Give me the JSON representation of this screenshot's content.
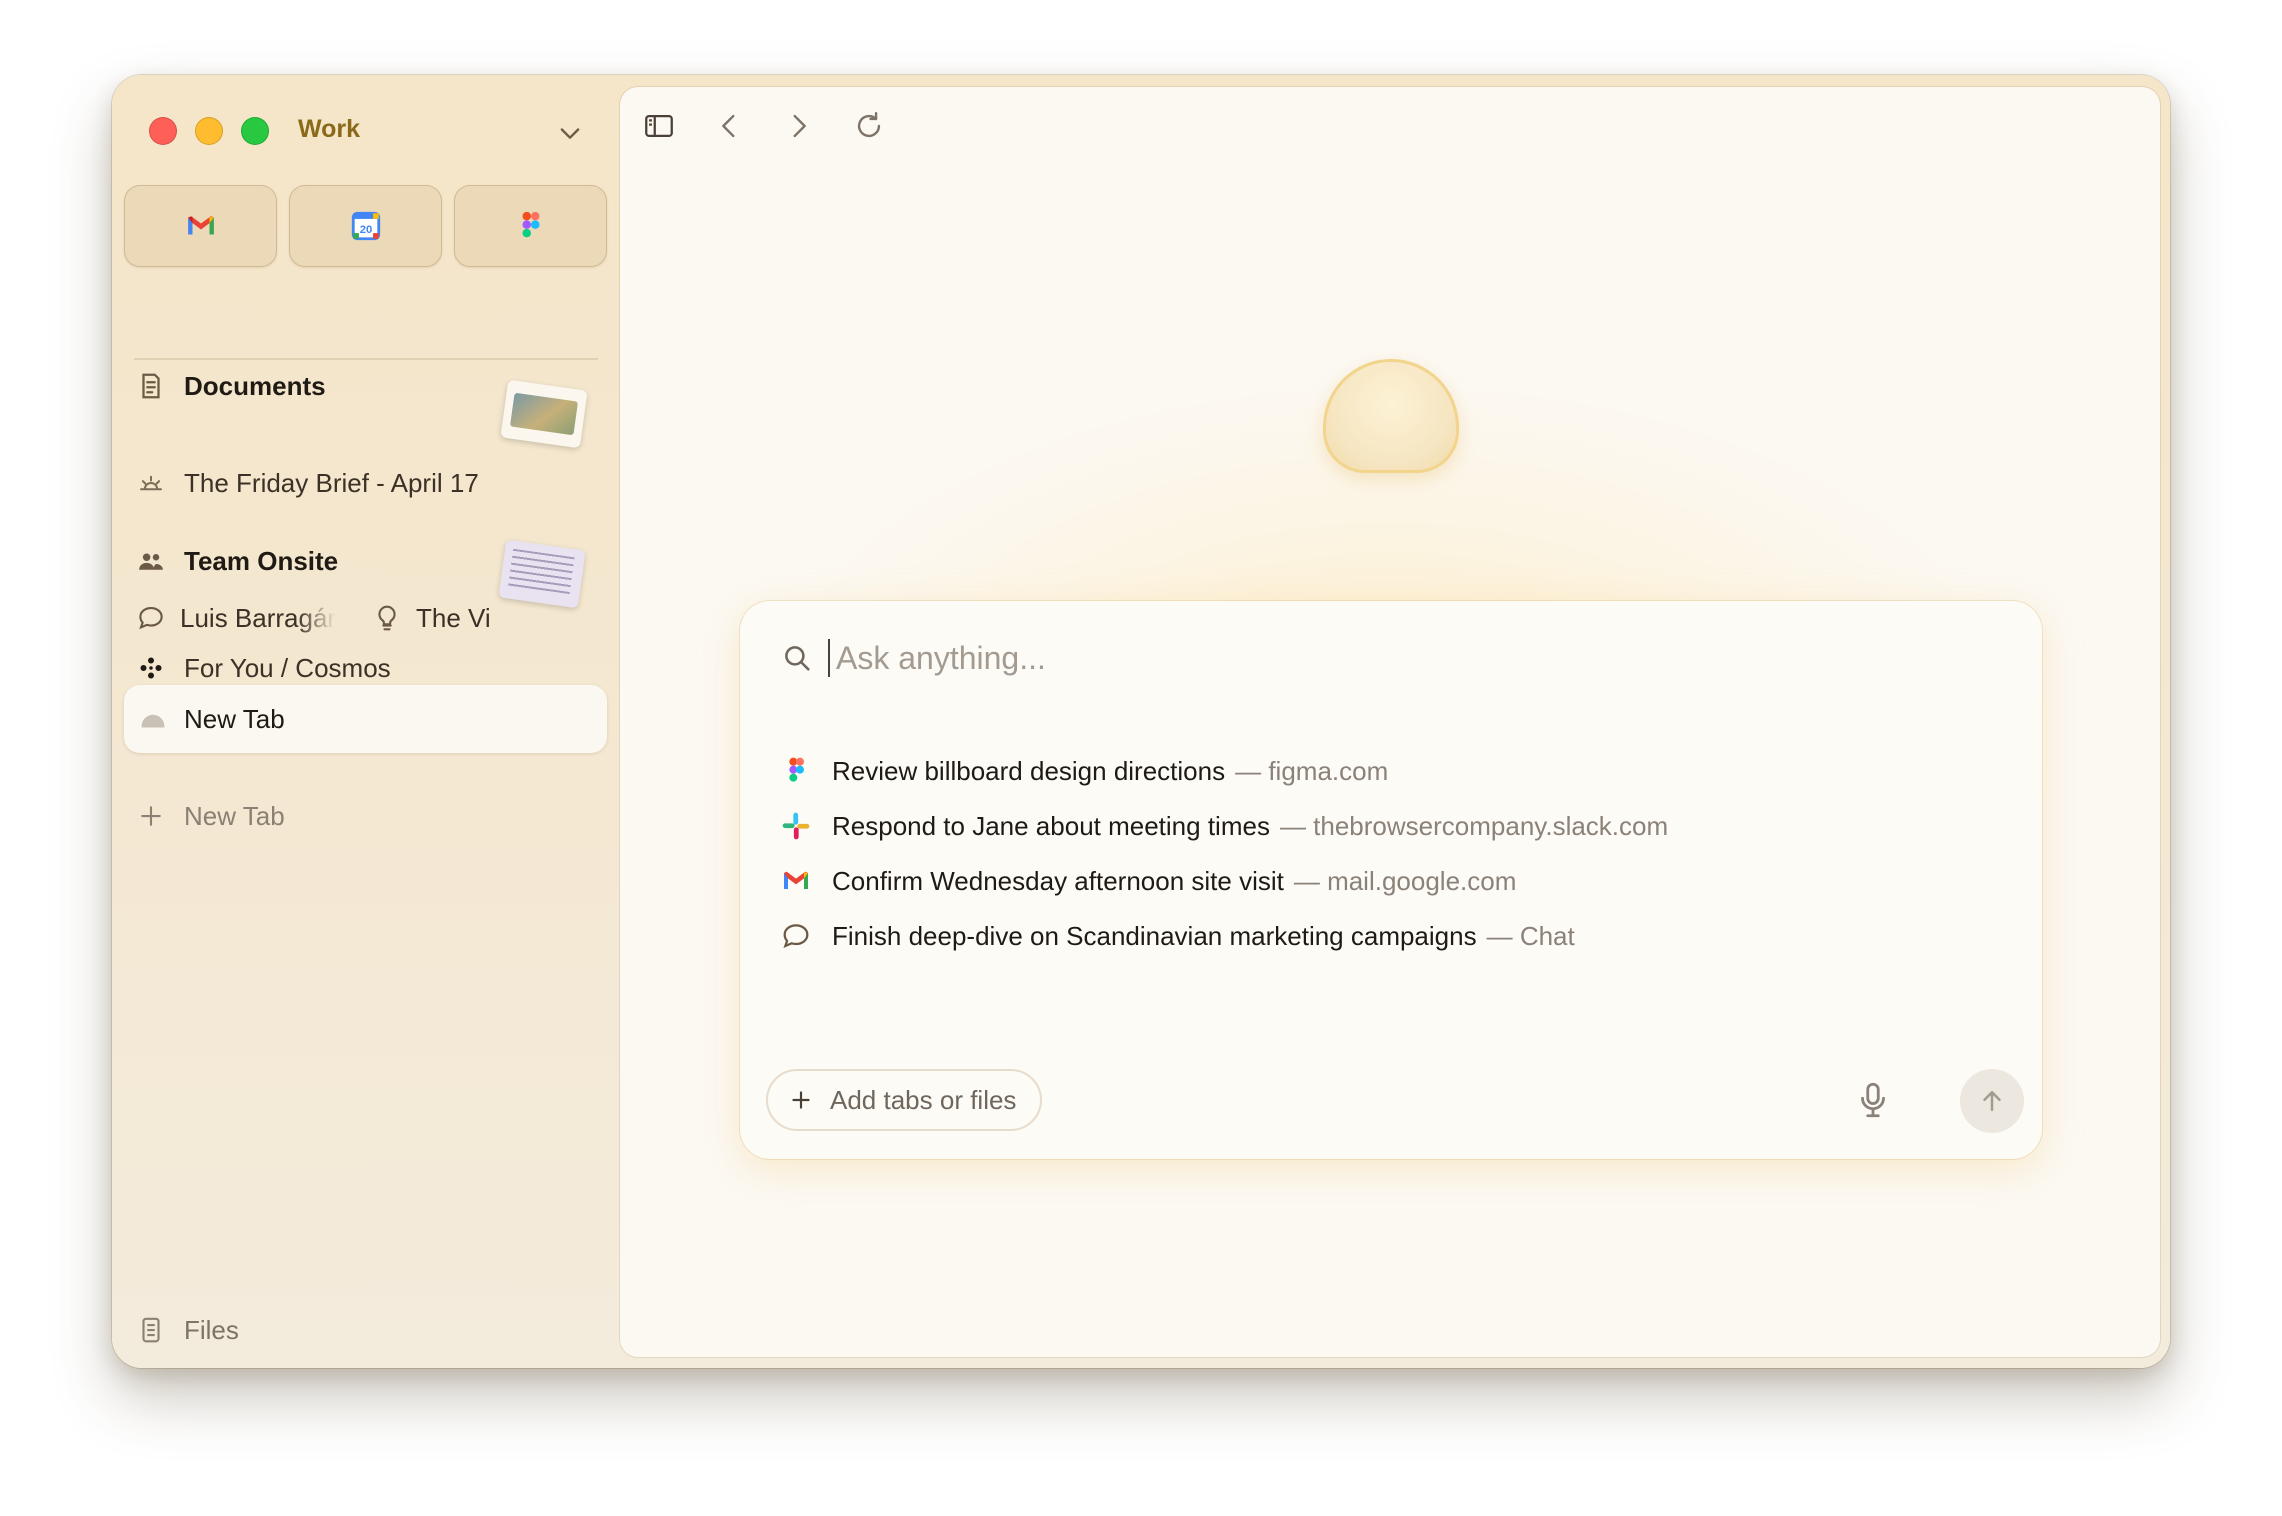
{
  "window": {
    "space_name": "Work",
    "pinned": [
      {
        "icon": "gmail-icon"
      },
      {
        "icon": "google-calendar-icon",
        "badge": "20"
      },
      {
        "icon": "figma-icon"
      }
    ],
    "sidebar": {
      "documents_label": "Documents",
      "items": [
        {
          "label": "The Friday Brief - April 17",
          "icon": "sunrise-icon"
        },
        {
          "label": "Team Onsite",
          "icon": "people-icon"
        },
        {
          "label": "Luis Barragán",
          "icon": "chat-bubble-icon"
        },
        {
          "label": "The Vi",
          "icon": "lightbulb-icon"
        },
        {
          "label": "For You / Cosmos",
          "icon": "cosmos-icon"
        }
      ],
      "active_tab": "New Tab",
      "new_tab_label": "New Tab",
      "files_label": "Files"
    }
  },
  "main": {
    "search_placeholder": "Ask anything...",
    "suggestions": [
      {
        "text": "Review billboard design directions",
        "source": "— figma.com",
        "icon": "figma-icon"
      },
      {
        "text": "Respond to Jane about meeting times",
        "source": "— thebrowsercompany.slack.com",
        "icon": "slack-icon"
      },
      {
        "text": "Confirm Wednesday afternoon site visit",
        "source": "— mail.google.com",
        "icon": "gmail-icon"
      },
      {
        "text": "Finish deep-dive on Scandinavian marketing campaigns",
        "source": "— Chat",
        "icon": "chat-bubble-icon"
      }
    ],
    "add_button_label": "Add tabs or files"
  },
  "colors": {
    "accent": "#8a6a18",
    "traffic_red": "#fe5f57",
    "traffic_yellow": "#febc2e",
    "traffic_green": "#28c840"
  }
}
